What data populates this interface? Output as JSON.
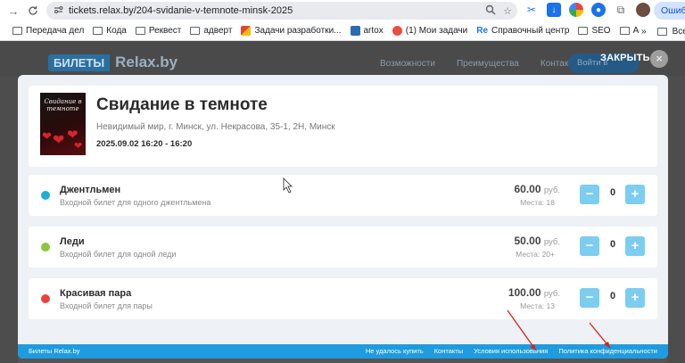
{
  "browser": {
    "url": "tickets.relax.by/204-svidanie-v-temnote-minsk-2025",
    "error_label": "Ошибка",
    "bookmarks": [
      {
        "label": "Передача дел",
        "icon": "folder-icon"
      },
      {
        "label": "Кода",
        "icon": "folder-icon"
      },
      {
        "label": "Реквест",
        "icon": "folder-icon"
      },
      {
        "label": "адверт",
        "icon": "folder-icon"
      },
      {
        "label": "Задачи разработки...",
        "icon": "google-docs-icon"
      },
      {
        "label": "artox",
        "icon": "artox-icon"
      },
      {
        "label": "(1) Мои задачи",
        "icon": "tasks-icon"
      },
      {
        "label": "Справочный центр",
        "icon": "re-icon"
      },
      {
        "label": "SEO",
        "icon": "folder-icon"
      },
      {
        "label": "Афиша",
        "icon": "folder-icon"
      }
    ],
    "all_bookmarks_label": "Все закла",
    "more_symbol": "»"
  },
  "site": {
    "logo_left": "БИЛЕТЫ",
    "logo_right": "Relax.by",
    "nav": [
      "Возможности",
      "Преимущества",
      "Контакты"
    ],
    "login_label": "Войти в кабинет",
    "close_label": "ЗАКРЫТЬ",
    "close_symbol": "×"
  },
  "event": {
    "title": "Свидание в темноте",
    "place": "Невидимый мир, г. Минск, ул. Некрасова, 35-1, 2Н, Минск",
    "datetime": "2025.09.02 16:20 - 16:20",
    "poster_title": "Свидание в темноте"
  },
  "tickets": [
    {
      "name": "Джентльмен",
      "desc": "Входной билет для одного джентльмена",
      "price": "60.00",
      "currency": "руб.",
      "places": "Места: 18",
      "qty": "0",
      "color": "#1ab0d6"
    },
    {
      "name": "Леди",
      "desc": "Входной билет для одной леди",
      "price": "50.00",
      "currency": "руб.",
      "places": "Места: 20+",
      "qty": "0",
      "color": "#8cc63e"
    },
    {
      "name": "Красивая пара",
      "desc": "Входной билет для пары",
      "price": "100.00",
      "currency": "руб.",
      "places": "Места: 13",
      "qty": "0",
      "color": "#e8433d"
    }
  ],
  "buttons": {
    "minus": "−",
    "plus": "+"
  },
  "footer": {
    "brand": "Билеты Relax.by",
    "links": [
      "Не удалось купить",
      "Контакты",
      "Условия использования",
      "Политика конфиденциальности"
    ]
  },
  "colors": {
    "accent": "#1f9be0",
    "button": "#7ccdf0",
    "annotation_arrows": "#d9221c"
  }
}
